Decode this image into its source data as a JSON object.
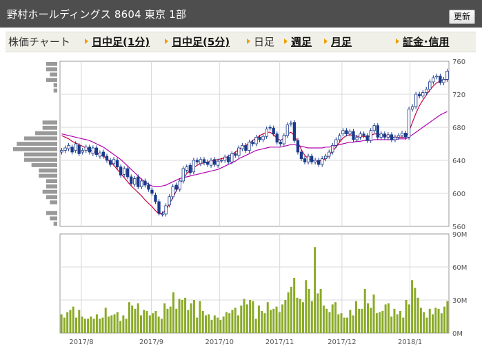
{
  "header": {
    "title": "野村ホールディングス  8604  東京 1部",
    "refresh_label": "更新"
  },
  "tabs": [
    {
      "label": "株価チャート",
      "arrow": false,
      "link": false
    },
    {
      "label": "日中足(1分)",
      "arrow": true,
      "link": true
    },
    {
      "label": "日中足(5分)",
      "arrow": true,
      "link": true
    },
    {
      "label": "日足",
      "arrow": true,
      "link": false
    },
    {
      "label": "週足",
      "arrow": true,
      "link": true
    },
    {
      "label": "月足",
      "arrow": true,
      "link": true
    },
    {
      "label": "証金･信用",
      "arrow": true,
      "link": true
    }
  ],
  "colors": {
    "accent_arrow": "#e8a000",
    "up_candle": "#ffffff",
    "down_candle": "#1a3a8a",
    "ma_short": "#c8003c",
    "ma_long": "#b000b0",
    "volume": "#8aaa28",
    "volume_profile": "#999999"
  },
  "chart_data": {
    "type": "candlestick",
    "x_tick_labels": [
      "2017/8",
      "2017/9",
      "2017/10",
      "2017/11",
      "2017/12",
      "2018/1"
    ],
    "price_axis": {
      "ylim": [
        560,
        760
      ],
      "ticks": [
        560,
        600,
        640,
        680,
        720,
        760
      ]
    },
    "volume_axis": {
      "ylim": [
        0,
        90
      ],
      "unit": "M",
      "tick_labels": [
        "0M",
        "30M",
        "60M",
        "90M"
      ]
    },
    "volume_profile": [
      3,
      3,
      2,
      3,
      1,
      1,
      0,
      0,
      0,
      0,
      0,
      4,
      4,
      6,
      9,
      11,
      12,
      9,
      9,
      7,
      5,
      5,
      3,
      3,
      4,
      3,
      2,
      0,
      3,
      2,
      1
    ],
    "closes": [
      652,
      655,
      658,
      650,
      660,
      648,
      652,
      656,
      650,
      655,
      647,
      649,
      645,
      640,
      635,
      641,
      632,
      622,
      630,
      620,
      612,
      618,
      608,
      615,
      610,
      605,
      600,
      590,
      576,
      575,
      585,
      596,
      608,
      605,
      615,
      630,
      632,
      625,
      640,
      638,
      641,
      637,
      635,
      640,
      635,
      639,
      640,
      644,
      638,
      648,
      646,
      655,
      658,
      652,
      662,
      660,
      668,
      665,
      669,
      678,
      679,
      672,
      662,
      660,
      670,
      683,
      685,
      664,
      650,
      642,
      638,
      645,
      638,
      640,
      635,
      642,
      645,
      650,
      658,
      665,
      670,
      676,
      672,
      675,
      665,
      668,
      672,
      670,
      664,
      676,
      682,
      668,
      672,
      668,
      671,
      665,
      668,
      670,
      673,
      668,
      702,
      705,
      720,
      718,
      722,
      726,
      735,
      740,
      742,
      734,
      738,
      748
    ],
    "opens": [
      650,
      652,
      654,
      656,
      652,
      658,
      650,
      652,
      656,
      648,
      655,
      645,
      650,
      645,
      640,
      636,
      640,
      632,
      623,
      630,
      620,
      611,
      620,
      608,
      615,
      610,
      604,
      598,
      590,
      575,
      575,
      586,
      596,
      610,
      605,
      615,
      628,
      634,
      626,
      640,
      636,
      641,
      638,
      634,
      641,
      634,
      640,
      640,
      644,
      638,
      648,
      646,
      654,
      658,
      652,
      662,
      660,
      668,
      665,
      669,
      680,
      679,
      672,
      662,
      660,
      670,
      684,
      686,
      664,
      650,
      642,
      638,
      645,
      638,
      640,
      635,
      642,
      645,
      650,
      658,
      665,
      672,
      676,
      672,
      675,
      665,
      668,
      672,
      670,
      664,
      676,
      682,
      668,
      672,
      668,
      671,
      665,
      668,
      670,
      673,
      668,
      702,
      705,
      720,
      718,
      722,
      726,
      735,
      741,
      742,
      734,
      738
    ],
    "ma_short": [
      670,
      668,
      666,
      663,
      661,
      659,
      657,
      655,
      653,
      651,
      649,
      647,
      645,
      642,
      638,
      634,
      629,
      624,
      619,
      614,
      609,
      605,
      601,
      597,
      592,
      588,
      584,
      579,
      575,
      576,
      580,
      587,
      595,
      603,
      611,
      618,
      624,
      628,
      631,
      634,
      636,
      637,
      638,
      639,
      640,
      641,
      642,
      643,
      645,
      647,
      650,
      653,
      656,
      658,
      661,
      664,
      667,
      670,
      672,
      674,
      674,
      671,
      667,
      664,
      667,
      672,
      674,
      670,
      662,
      653,
      646,
      642,
      640,
      639,
      639,
      640,
      642,
      646,
      651,
      656,
      662,
      667,
      670,
      671,
      670,
      669,
      669,
      669,
      668,
      670,
      672,
      672,
      671,
      670,
      669,
      668,
      668,
      668,
      668,
      668,
      675,
      686,
      697,
      706,
      713,
      719,
      725,
      730,
      734,
      736,
      737,
      738
    ],
    "ma_long": [
      672,
      671,
      670,
      669,
      668,
      667,
      666,
      665,
      664,
      662,
      660,
      658,
      656,
      653,
      650,
      647,
      644,
      641,
      637,
      633,
      629,
      625,
      621,
      617,
      614,
      611,
      609,
      608,
      608,
      609,
      610,
      612,
      614,
      616,
      618,
      619,
      620,
      621,
      622,
      623,
      624,
      625,
      626,
      627,
      628,
      629,
      631,
      633,
      635,
      637,
      639,
      642,
      644,
      646,
      648,
      650,
      652,
      653,
      654,
      655,
      656,
      656,
      656,
      656,
      657,
      658,
      659,
      659,
      658,
      657,
      656,
      655,
      655,
      655,
      655,
      655,
      656,
      656,
      657,
      658,
      659,
      660,
      661,
      662,
      662,
      663,
      663,
      664,
      664,
      664,
      665,
      665,
      665,
      665,
      665,
      665,
      665,
      666,
      666,
      666,
      668,
      671,
      674,
      677,
      680,
      683,
      686,
      689,
      692,
      695,
      697,
      699
    ],
    "volume_m": [
      17,
      14,
      19,
      21,
      24,
      14,
      21,
      15,
      13,
      13,
      15,
      13,
      17,
      13,
      14,
      23,
      15,
      16,
      17,
      19,
      11,
      16,
      13,
      28,
      25,
      22,
      27,
      16,
      21,
      20,
      16,
      18,
      20,
      15,
      13,
      27,
      22,
      24,
      37,
      22,
      31,
      30,
      32,
      21,
      27,
      30,
      14,
      29,
      20,
      16,
      17,
      12,
      16,
      14,
      12,
      15,
      19,
      18,
      21,
      23,
      16,
      25,
      31,
      26,
      30,
      29,
      13,
      25,
      20,
      18,
      28,
      21,
      22,
      24,
      19,
      26,
      30,
      37,
      42,
      50,
      32,
      31,
      28,
      48,
      40,
      29,
      78,
      36,
      40,
      25,
      22,
      19,
      26,
      28,
      17,
      18,
      14,
      14,
      21,
      16,
      29,
      22,
      22,
      40,
      27,
      23,
      35,
      18,
      19,
      20,
      26,
      27,
      15,
      22,
      17,
      20,
      14,
      30,
      26,
      48,
      41,
      32,
      23,
      19,
      14,
      22,
      17,
      23,
      22,
      18,
      24,
      29
    ]
  }
}
